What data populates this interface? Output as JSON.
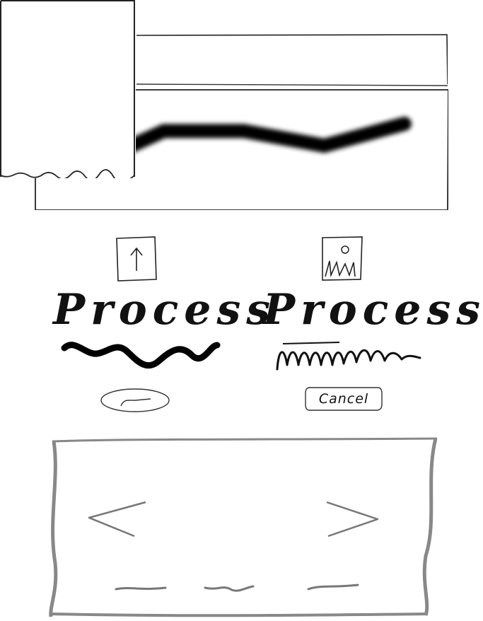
{
  "header": {
    "bar_label": ""
  },
  "chart": {
    "type": "line",
    "values": [
      0.0,
      0.5,
      0.5,
      0.3,
      0.6
    ]
  },
  "actions": {
    "left": {
      "icon": "upload-icon",
      "title": "Process",
      "button_label": ""
    },
    "right": {
      "icon": "image-icon",
      "title": "Process",
      "button_label": "Cancel"
    }
  },
  "carousel": {
    "prev_icon": "chevron-left-icon",
    "next_icon": "chevron-right-icon",
    "page_count": 3
  },
  "colors": {
    "ink": "#111111",
    "pencil": "#777777",
    "paper": "#ffffff"
  }
}
